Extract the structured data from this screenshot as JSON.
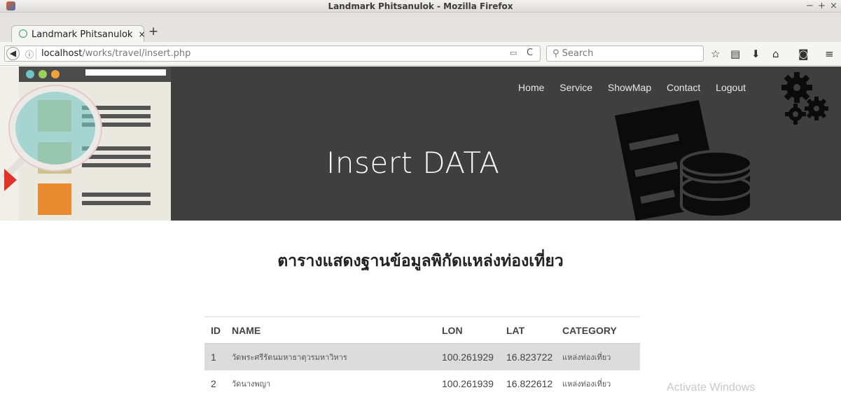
{
  "window": {
    "title": "Landmark Phitsanulok - Mozilla Firefox",
    "controls": [
      "−",
      "+",
      "×"
    ]
  },
  "tab": {
    "label": "Landmark Phitsanulok",
    "close": "×",
    "new_tab": "+"
  },
  "navbar": {
    "url_host": "localhost",
    "url_path": "/works/travel/insert.php",
    "search_placeholder": "Search",
    "icons": [
      "back-icon",
      "info-icon",
      "reader-icon",
      "reload-icon",
      "bookmark-star-icon",
      "reading-list-icon",
      "download-icon",
      "home-icon",
      "pocket-icon",
      "menu-icon"
    ]
  },
  "site": {
    "nav": [
      "Home",
      "Service",
      "ShowMap",
      "Contact",
      "Logout"
    ],
    "hero_title": "Insert DATA",
    "heading": "ตารางแสดงฐานข้อมูลพิกัดแหล่งท่องเที่ยว"
  },
  "table": {
    "headers": [
      "ID",
      "NAME",
      "LON",
      "LAT",
      "CATEGORY"
    ],
    "rows": [
      [
        "1",
        "วัดพระศรีรัตนมหาธาตุวรมหาวิหาร",
        "100.261929",
        "16.823722",
        "แหล่งท่องเที่ยว"
      ],
      [
        "2",
        "วัดนางพญา",
        "100.261939",
        "16.822612",
        "แหล่งท่องเที่ยว"
      ]
    ]
  },
  "watermark": "Activate Windows",
  "colors": {
    "hero": "#3f3f3f",
    "row_stripe": "#dcdcdc",
    "accent_orange": "#e98b2f"
  }
}
